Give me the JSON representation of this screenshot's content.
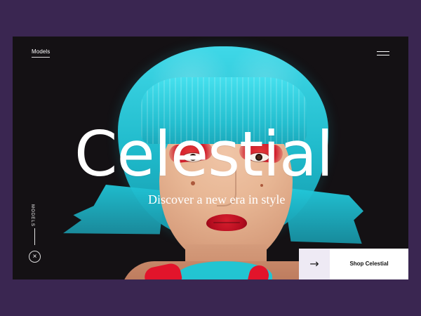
{
  "page": {
    "background_color": "#3a2651",
    "frame_color": "#120f12"
  },
  "nav": {
    "models_label": "Models"
  },
  "hero": {
    "title": "Celestial",
    "subtitle": "Discover a new era in style",
    "image_semantic": "portrait-model-with-blue-bob-hair",
    "hair_color": "#24bfd0",
    "accent_red": "#e2142b"
  },
  "side": {
    "vertical_label": "MODELS",
    "close_icon": "×"
  },
  "cta": {
    "label": "Shop Celestial",
    "arrow_icon": "→",
    "arrow_box_color": "#eeeaf4",
    "label_box_color": "#ffffff"
  },
  "icons": {
    "menu": "menu-icon",
    "close": "close-icon",
    "arrow": "arrow-right-icon"
  }
}
